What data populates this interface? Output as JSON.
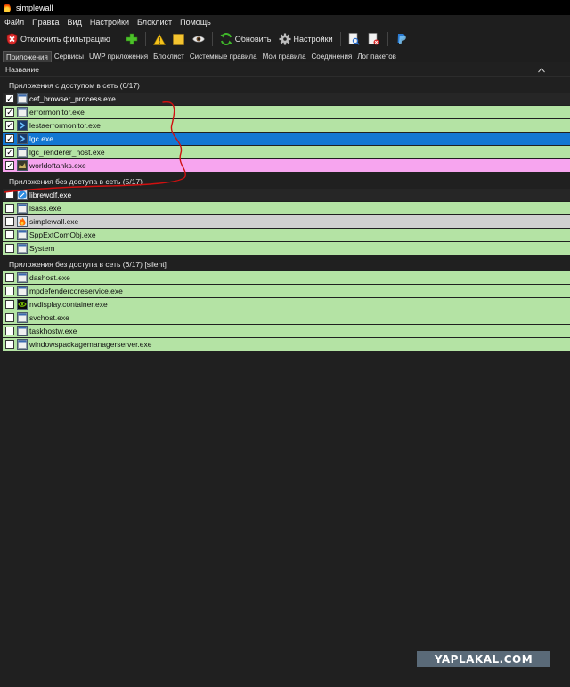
{
  "window": {
    "title": "simplewall"
  },
  "menu": [
    "Файл",
    "Правка",
    "Вид",
    "Настройки",
    "Блоклист",
    "Помощь"
  ],
  "toolbar": {
    "disable_filter": "Отключить фильтрацию",
    "refresh": "Обновить",
    "settings": "Настройки"
  },
  "tabs": [
    {
      "label": "Приложения",
      "active": true
    },
    {
      "label": "Сервисы",
      "active": false
    },
    {
      "label": "UWP приложения",
      "active": false
    },
    {
      "label": "Блоклист",
      "active": false
    },
    {
      "label": "Системные правила",
      "active": false
    },
    {
      "label": "Мои правила",
      "active": false
    },
    {
      "label": "Соединения",
      "active": false
    },
    {
      "label": "Лог пакетов",
      "active": false
    }
  ],
  "column_header": "Название",
  "groups": [
    {
      "title": "Приложения с доступом в сеть (6/17)",
      "rows": [
        {
          "name": "cef_browser_process.exe",
          "checked": true,
          "color": "dark",
          "icon": "app-icon"
        },
        {
          "name": "errormonitor.exe",
          "checked": true,
          "color": "green",
          "icon": "app-icon"
        },
        {
          "name": "lestaerrormonitor.exe",
          "checked": true,
          "color": "green",
          "icon": "chevron-app-icon"
        },
        {
          "name": "lgc.exe",
          "checked": true,
          "color": "blue",
          "icon": "chevron-app-icon"
        },
        {
          "name": "lgc_renderer_host.exe",
          "checked": true,
          "color": "green",
          "icon": "app-icon"
        },
        {
          "name": "worldoftanks.exe",
          "checked": true,
          "color": "pink",
          "icon": "tank-icon"
        }
      ]
    },
    {
      "title": "Приложения без доступа в сеть (5/17)",
      "rows": [
        {
          "name": "librewolf.exe",
          "checked": false,
          "color": "dark",
          "icon": "librewolf-icon"
        },
        {
          "name": "lsass.exe",
          "checked": false,
          "color": "green",
          "icon": "app-icon"
        },
        {
          "name": "simplewall.exe",
          "checked": false,
          "color": "gray",
          "icon": "flame-icon"
        },
        {
          "name": "SppExtComObj.exe",
          "checked": false,
          "color": "green",
          "icon": "app-icon"
        },
        {
          "name": "System",
          "checked": false,
          "color": "green",
          "icon": "app-icon"
        }
      ]
    },
    {
      "title": "Приложения без доступа в сеть (6/17) [silent]",
      "rows": [
        {
          "name": "dashost.exe",
          "checked": false,
          "color": "green",
          "icon": "app-icon"
        },
        {
          "name": "mpdefendercoreservice.exe",
          "checked": false,
          "color": "green",
          "icon": "app-icon"
        },
        {
          "name": "nvdisplay.container.exe",
          "checked": false,
          "color": "green",
          "icon": "nvidia-icon"
        },
        {
          "name": "svchost.exe",
          "checked": false,
          "color": "green",
          "icon": "app-icon"
        },
        {
          "name": "taskhostw.exe",
          "checked": false,
          "color": "green",
          "icon": "app-icon"
        },
        {
          "name": "windowspackagemanagerserver.exe",
          "checked": false,
          "color": "green",
          "icon": "app-icon"
        }
      ]
    }
  ],
  "watermark": "YAPLAKAL.COM",
  "colors": {
    "green": "#b4e3a4",
    "blue": "#1277d2",
    "pink": "#f7a5ef",
    "gray": "#d0d0d0",
    "dark": "#262626",
    "annotation": "#d01010"
  }
}
